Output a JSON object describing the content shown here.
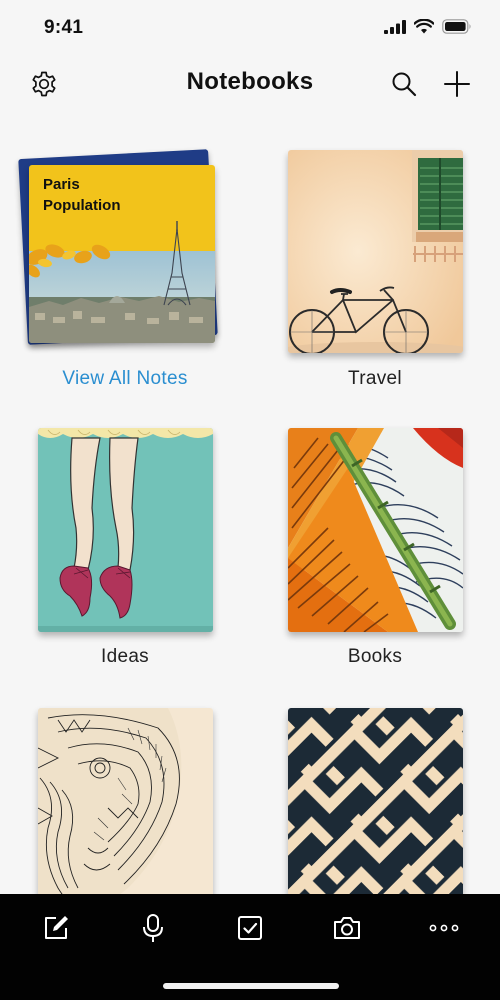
{
  "status_bar": {
    "time": "9:41"
  },
  "nav": {
    "title": "Notebooks",
    "settings_icon": "gear-icon",
    "search_icon": "search-icon",
    "add_icon": "plus-icon"
  },
  "notebooks": [
    {
      "label": "View All Notes",
      "cover_title_line1": "Paris",
      "cover_title_line2": "Population",
      "cover_color": "#f2c31b"
    },
    {
      "label": "Travel"
    },
    {
      "label": "Ideas"
    },
    {
      "label": "Books"
    },
    {
      "label": ""
    },
    {
      "label": ""
    }
  ],
  "colors": {
    "link": "#2a8ed0",
    "tab_bar": "#020202",
    "background": "#f6f6f6"
  },
  "tab_bar": {
    "icons": [
      "pencil-icon",
      "microphone-icon",
      "checkbox-icon",
      "camera-icon",
      "more-icon"
    ]
  }
}
